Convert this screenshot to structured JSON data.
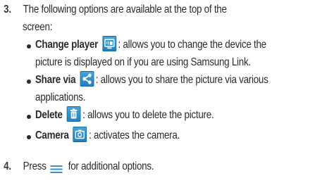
{
  "step3": {
    "number": "3.",
    "line1": "The following options are available at the top of the",
    "line2": "screen:"
  },
  "bullets": [
    {
      "term": "Change player",
      "icon": "change-player-icon",
      "text1": ": allows you to change the device the",
      "text2": "picture is displayed on if you are using Samsung Link."
    },
    {
      "term": "Share via",
      "icon": "share-icon",
      "text1": ": allows you to share the picture via various",
      "text2": "applications."
    },
    {
      "term": "Delete",
      "icon": "trash-icon",
      "text1": ": allows you to delete the picture."
    },
    {
      "term": "Camera",
      "icon": "camera-icon",
      "text1": ": activates the camera."
    }
  ],
  "step4": {
    "number": "4.",
    "before": "Press",
    "icon": "menu-key-icon",
    "after": "for additional options."
  },
  "colors": {
    "icon_blue": "#2a8ccb",
    "text": "#2b2b2b"
  }
}
